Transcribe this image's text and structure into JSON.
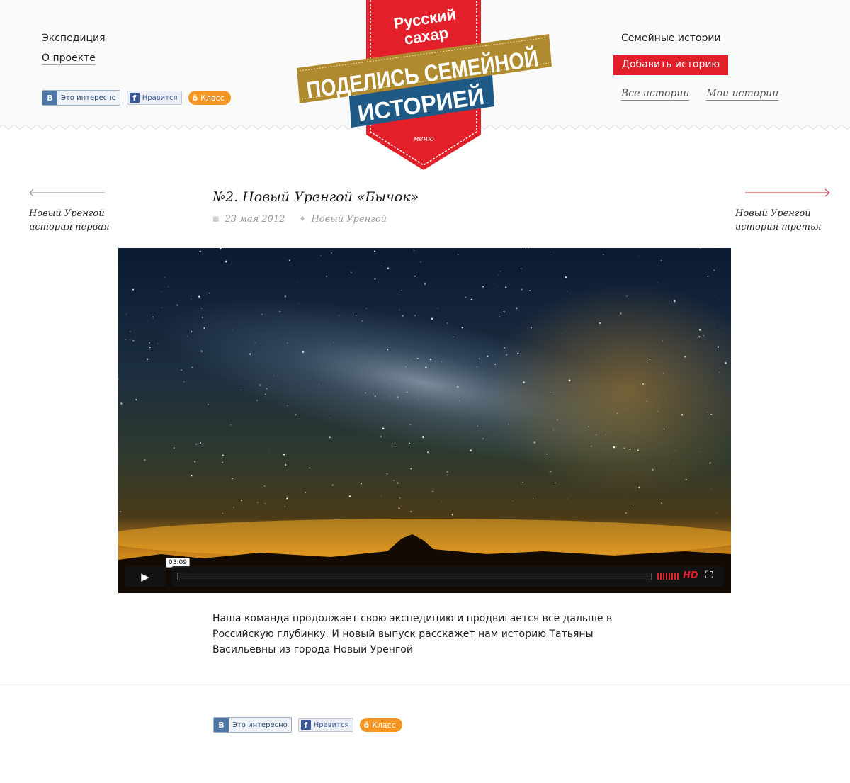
{
  "nav_left": {
    "expedition": "Экспедиция",
    "about": "О проекте"
  },
  "nav_right": {
    "family_stories": "Семейные истории",
    "add_story": "Добавить историю",
    "all_stories": "Все истории",
    "my_stories": "Мои истории"
  },
  "logo": {
    "brand_line1": "Русский",
    "brand_line2": "сахар",
    "banner_line1": "ПОДЕЛИСЬ СЕМЕЙНОЙ",
    "banner_line2": "ИСТОРИЕЙ",
    "menu": "меню"
  },
  "social": {
    "vk_letter": "В",
    "vk_label": "Это интересно",
    "fb_letter": "f",
    "fb_label": "Нравится",
    "ok_letter": "ǒ",
    "ok_label": "Класс"
  },
  "story": {
    "title": "№2. Новый Уренгой «Бычок»",
    "date": "23 мая 2012",
    "location": "Новый Уренгой",
    "prev_line1": "Новый Уренгой",
    "prev_line2": "история первая",
    "next_line1": "Новый Уренгой",
    "next_line2": "история третья",
    "description": "Наша команда продолжает свою экспедицию и продвигается все дальше в Российскую глубинку. И новый выпуск расскажет нам историю Татьяны Васильевны из города Новый Уренгой"
  },
  "video": {
    "duration": "03:09",
    "hd_label": "HD",
    "play_icon": "play-icon",
    "fullscreen_icon": "fullscreen-icon"
  },
  "colors": {
    "accent_red": "#e3202a",
    "banner_gold": "#b08a2e",
    "banner_blue": "#1f5a86"
  }
}
